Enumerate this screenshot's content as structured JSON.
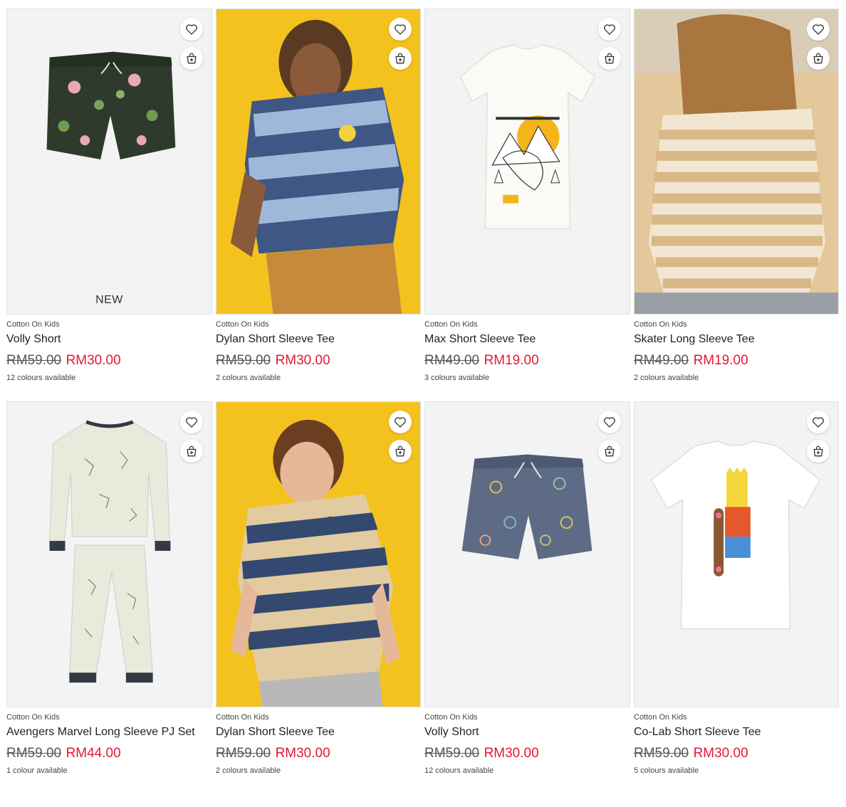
{
  "products": [
    {
      "brand": "Cotton On Kids",
      "name": "Volly Short",
      "was": "RM59.00",
      "now": "RM30.00",
      "colours": "12 colours available",
      "badge": "NEW",
      "image": "floral-swim-shorts"
    },
    {
      "brand": "Cotton On Kids",
      "name": "Dylan Short Sleeve Tee",
      "was": "RM59.00",
      "now": "RM30.00",
      "colours": "2 colours available",
      "badge": "",
      "image": "boy-striped-tee-yellow-backdrop"
    },
    {
      "brand": "Cotton On Kids",
      "name": "Max Short Sleeve Tee",
      "was": "RM49.00",
      "now": "RM19.00",
      "colours": "3 colours available",
      "badge": "",
      "image": "white-dinosaur-graphic-tee"
    },
    {
      "brand": "Cotton On Kids",
      "name": "Skater Long Sleeve Tee",
      "was": "RM49.00",
      "now": "RM19.00",
      "colours": "2 colours available",
      "badge": "",
      "image": "child-striped-long-sleeve"
    },
    {
      "brand": "Cotton On Kids",
      "name": "Avengers Marvel Long Sleeve PJ Set",
      "was": "RM59.00",
      "now": "RM44.00",
      "colours": "1 colour available",
      "badge": "",
      "image": "printed-pj-set"
    },
    {
      "brand": "Cotton On Kids",
      "name": "Dylan Short Sleeve Tee",
      "was": "RM59.00",
      "now": "RM30.00",
      "colours": "2 colours available",
      "badge": "",
      "image": "boy-striped-tee-dino"
    },
    {
      "brand": "Cotton On Kids",
      "name": "Volly Short",
      "was": "RM59.00",
      "now": "RM30.00",
      "colours": "12 colours available",
      "badge": "",
      "image": "navy-splat-shorts"
    },
    {
      "brand": "Cotton On Kids",
      "name": "Co-Lab Short Sleeve Tee",
      "was": "RM59.00",
      "now": "RM30.00",
      "colours": "5 colours available",
      "badge": "",
      "image": "white-bart-tee"
    }
  ],
  "icons": {
    "wishlist": "heart-icon",
    "add_to_bag": "bag-plus-icon"
  },
  "colors": {
    "sale": "#e31836",
    "photo_backdrop": "#f4c21f"
  }
}
